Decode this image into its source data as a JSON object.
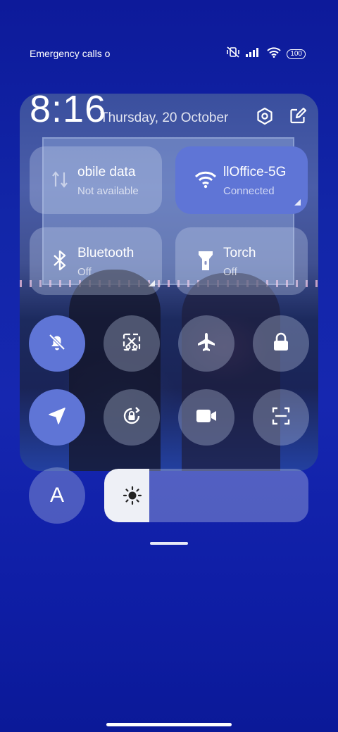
{
  "status_bar": {
    "carrier_text": "Emergency calls o",
    "battery": "100",
    "icons": [
      "mute-vibrate-icon",
      "signal-icon",
      "wifi-icon",
      "battery-icon"
    ]
  },
  "header": {
    "time": "8:16",
    "date": "Thursday, 20 October",
    "actions": [
      "settings-icon",
      "edit-icon"
    ]
  },
  "tiles": [
    {
      "name": "obile data",
      "status": "Not available",
      "icon": "mobile-data-icon",
      "active": false
    },
    {
      "name": "llOffice-5G",
      "status": "Connected",
      "icon": "wifi-icon",
      "active": true
    },
    {
      "name": "Bluetooth",
      "status": "Off",
      "icon": "bluetooth-icon",
      "active": false
    },
    {
      "name": "Torch",
      "status": "Off",
      "icon": "torch-icon",
      "active": false
    }
  ],
  "toggles_row1": [
    {
      "icon": "silent-bell-icon",
      "active": true
    },
    {
      "icon": "screenshot-icon",
      "active": false
    },
    {
      "icon": "airplane-icon",
      "active": false
    },
    {
      "icon": "lock-icon",
      "active": false
    }
  ],
  "toggles_row2": [
    {
      "icon": "location-icon",
      "active": true
    },
    {
      "icon": "rotation-lock-icon",
      "active": false
    },
    {
      "icon": "video-camera-icon",
      "active": false
    },
    {
      "icon": "scanner-icon",
      "active": false
    }
  ],
  "auto_brightness_label": "A",
  "brightness": {
    "level": 0.22
  },
  "colors": {
    "active": "#5f75d6",
    "background": "#1226a8"
  }
}
